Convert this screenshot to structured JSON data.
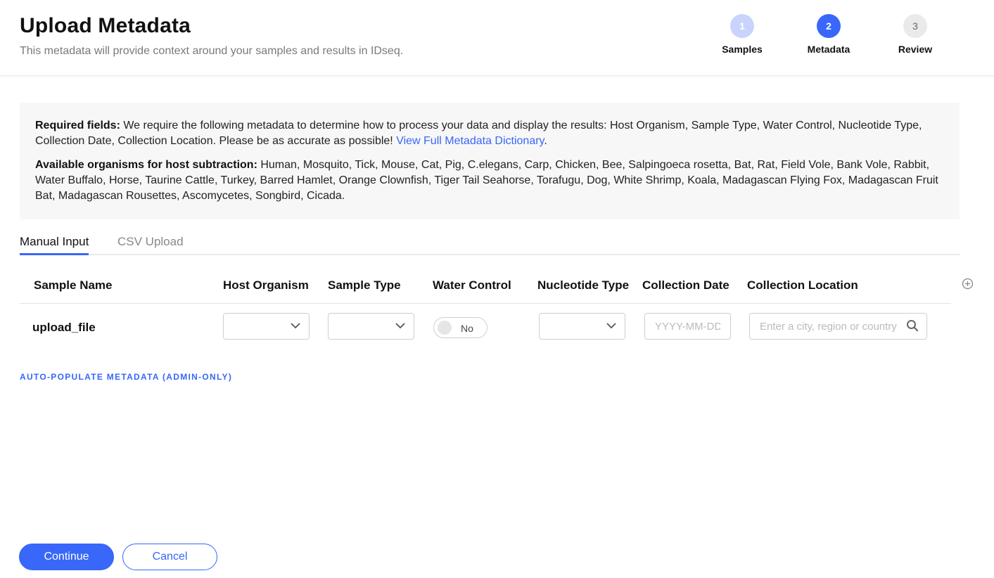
{
  "header": {
    "title": "Upload Metadata",
    "subtitle": "This metadata will provide context around your samples and results in IDseq."
  },
  "steps": [
    {
      "number": "1",
      "label": "Samples",
      "state": "done"
    },
    {
      "number": "2",
      "label": "Metadata",
      "state": "active"
    },
    {
      "number": "3",
      "label": "Review",
      "state": "todo"
    }
  ],
  "info": {
    "required_label": "Required fields:",
    "required_text": " We require the following metadata to determine how to process your data and display the results: Host Organism, Sample Type, Water Control, Nucleotide Type, Collection Date, Collection Location. Please be as accurate as possible! ",
    "dictionary_link": "View Full Metadata Dictionary",
    "required_end": ".",
    "organisms_label": "Available organisms for host subtraction:",
    "organisms_text": " Human, Mosquito, Tick, Mouse, Cat, Pig, C.elegans, Carp, Chicken, Bee, Salpingoeca rosetta, Bat, Rat, Field Vole, Bank Vole, Rabbit, Water Buffalo, Horse, Taurine Cattle, Turkey, Barred Hamlet, Orange Clownfish, Tiger Tail Seahorse, Torafugu, Dog, White Shrimp, Koala, Madagascan Flying Fox, Madagascan Fruit Bat, Madagascan Rousettes, Ascomycetes, Songbird, Cicada."
  },
  "tabs": [
    {
      "label": "Manual Input",
      "active": true
    },
    {
      "label": "CSV Upload",
      "active": false
    }
  ],
  "table": {
    "columns": [
      "Sample Name",
      "Host Organism",
      "Sample Type",
      "Water Control",
      "Nucleotide Type",
      "Collection Date",
      "Collection Location"
    ],
    "rows": [
      {
        "sample_name": "upload_file",
        "host_organism": "",
        "sample_type": "",
        "water_control": "No",
        "nucleotide_type": "",
        "collection_date_placeholder": "YYYY-MM-DD",
        "collection_location_placeholder": "Enter a city, region or country"
      }
    ]
  },
  "auto_populate_label": "AUTO-POPULATE METADATA (ADMIN-ONLY)",
  "actions": {
    "continue_label": "Continue",
    "cancel_label": "Cancel"
  },
  "colors": {
    "accent": "#3867fa",
    "step_done": "#c8d4fb",
    "info_bg": "#f7f7f7"
  }
}
